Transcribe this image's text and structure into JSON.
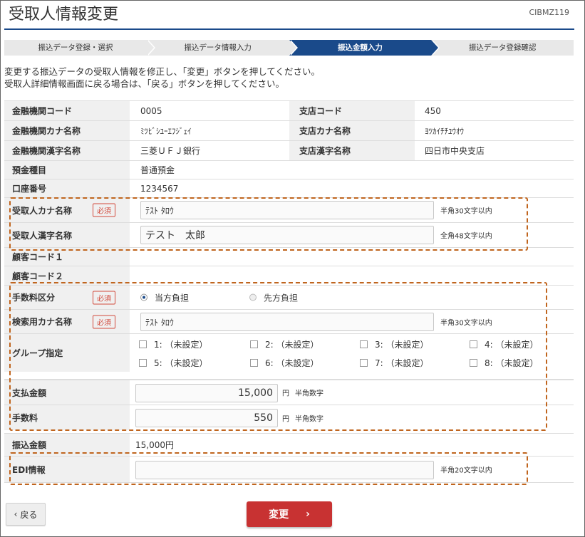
{
  "page": {
    "title": "受取人情報変更",
    "screen_id": "CIBMZ119"
  },
  "steps": [
    {
      "label": "振込データ登録・選択",
      "active": false
    },
    {
      "label": "振込データ情報入力",
      "active": false
    },
    {
      "label": "振込金額入力",
      "active": true
    },
    {
      "label": "振込データ登録確認",
      "active": false
    }
  ],
  "instructions": {
    "line1": "変更する振込データの受取人情報を修正し、「変更」ボタンを押してください。",
    "line2": "受取人詳細情報画面に戻る場合は、「戻る」ボタンを押してください。"
  },
  "bank": {
    "code_label": "金融機関コード",
    "code": "0005",
    "kana_label": "金融機関カナ名称",
    "kana": "ﾐﾂﾋﾞｼﾕｰｴﾌｼﾞｪｲ",
    "kanji_label": "金融機関漢字名称",
    "kanji": "三菱ＵＦＪ銀行"
  },
  "branch": {
    "code_label": "支店コード",
    "code": "450",
    "kana_label": "支店カナ名称",
    "kana": "ﾖﾂｶｲﾁﾁﾕｳｵｳ",
    "kanji_label": "支店漢字名称",
    "kanji": "四日市中央支店"
  },
  "deposit": {
    "type_label": "預金種目",
    "type": "普通預金",
    "account_label": "口座番号",
    "account": "1234567"
  },
  "required_badge": "必須",
  "recipient": {
    "kana_label": "受取人カナ名称",
    "kana_value": "ﾃｽﾄ ﾀﾛｳ",
    "kana_note": "半角30文字以内",
    "kanji_label": "受取人漢字名称",
    "kanji_value": "テスト　太郎",
    "kanji_note": "全角48文字以内"
  },
  "customer": {
    "code1_label": "顧客コード１",
    "code2_label": "顧客コード２"
  },
  "fee": {
    "label": "手数料区分",
    "options": [
      "当方負担",
      "先方負担"
    ],
    "selected": "当方負担"
  },
  "search": {
    "label": "検索用カナ名称",
    "value": "ﾃｽﾄ ﾀﾛｳ",
    "note": "半角30文字以内"
  },
  "group": {
    "label": "グループ指定",
    "items": [
      "1: （未設定）",
      "2: （未設定）",
      "3: （未設定）",
      "4: （未設定）",
      "5: （未設定）",
      "6: （未設定）",
      "7: （未設定）",
      "8: （未設定）"
    ]
  },
  "payment": {
    "label": "支払金額",
    "value": "15,000",
    "unit": "円",
    "note": "半角数字"
  },
  "fee_amount": {
    "label": "手数料",
    "value": "550",
    "unit": "円",
    "note": "半角数字"
  },
  "transfer": {
    "label": "振込金額",
    "value": "15,000円"
  },
  "edi": {
    "label": "EDI情報",
    "value": "",
    "note": "半角20文字以内"
  },
  "buttons": {
    "back": "戻る",
    "change": "変更"
  },
  "colors": {
    "accent": "#1a4a8a",
    "required": "#d24a3c",
    "highlight": "#c0651e",
    "primary_button": "#c83232"
  }
}
